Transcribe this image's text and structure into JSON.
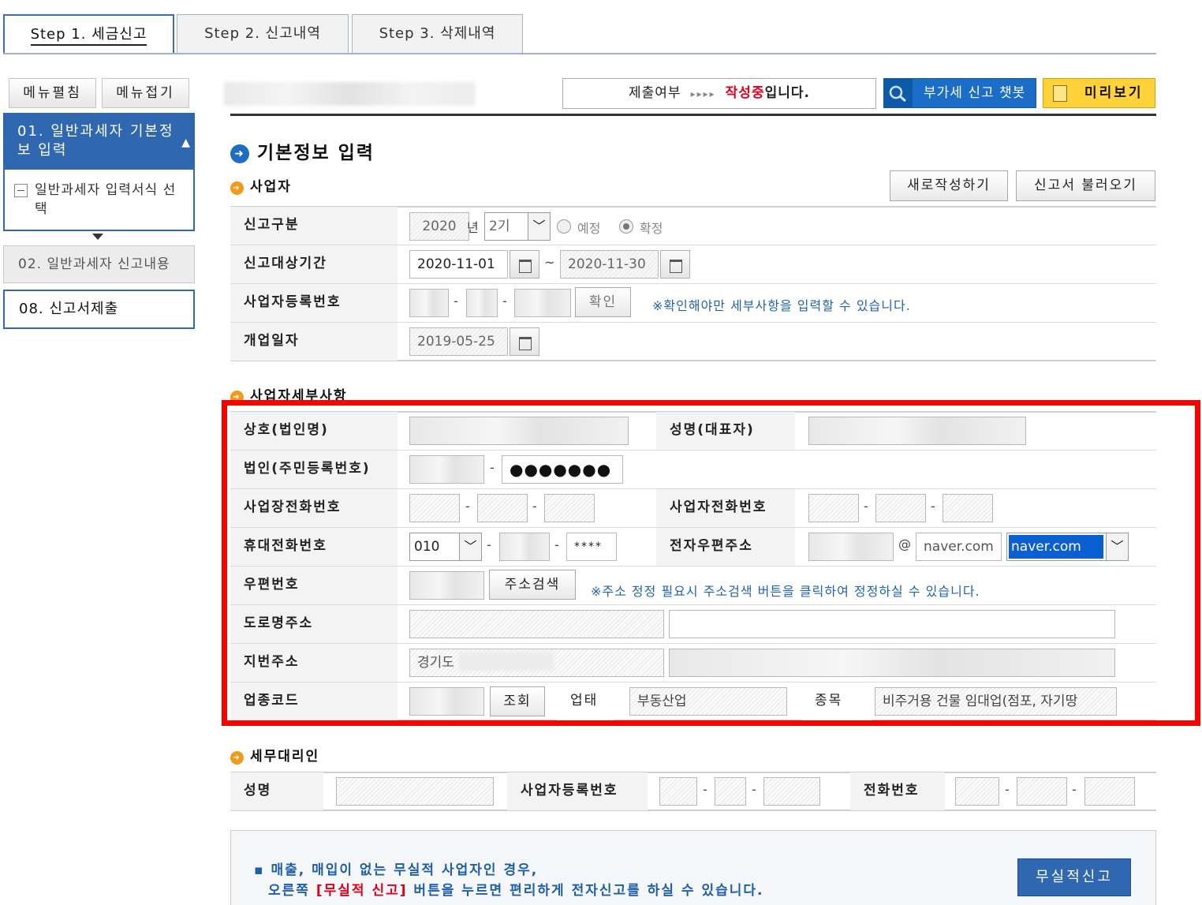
{
  "tabs": [
    {
      "label": "Step  1. 세금신고"
    },
    {
      "label": "Step  2. 신고내역"
    },
    {
      "label": "Step  3. 삭제내역"
    }
  ],
  "left_menu": {
    "expand_label": "메뉴펼침",
    "collapse_label": "메뉴접기",
    "active_item": "01. 일반과세자 기본정보 입력",
    "sub_item": "일반과세자 입력서식 선택",
    "item2": "02. 일반과세자 신고내용",
    "item3": "08. 신고서제출"
  },
  "status": {
    "prefix": "제출여부",
    "arrows": "▸▸▸▸",
    "state": "작성중",
    "suffix": "입니다."
  },
  "chatbot_label": "부가세 신고 챗봇",
  "preview_label": "미리보기",
  "section_title": "기본정보 입력",
  "business": {
    "heading": "사업자",
    "new_button": "새로작성하기",
    "load_button": "신고서 불러오기",
    "report_type_label": "신고구분",
    "year": "2020",
    "year_unit": "년",
    "period": "2기",
    "radio_prelim": "예정",
    "radio_final": "확정",
    "period_label": "신고대상기간",
    "period_start": "2020-11-01",
    "period_tilde": "~",
    "period_end": "2020-11-30",
    "biz_reg_label": "사업자등록번호",
    "confirm_button": "확인",
    "confirm_note": "※확인해야만 세부사항을 입력할 수 있습니다.",
    "open_date_label": "개업일자",
    "open_date": "2019-05-25"
  },
  "details": {
    "heading": "사업자세부사항",
    "company_label": "상호(법인명)",
    "rep_label": "성명(대표자)",
    "corp_id_label": "법인(주민등록번호)",
    "corp_id_masked": "●●●●●●●",
    "biz_phone_label": "사업장전화번호",
    "owner_phone_label": "사업자전화번호",
    "mobile_label": "휴대전화번호",
    "mobile_prefix": "010",
    "mobile_last": "****",
    "email_label": "전자우편주소",
    "email_at": "@",
    "email_domain": "naver.com",
    "email_domain_select": "naver.com",
    "zip_label": "우편번호",
    "address_search_button": "주소검색",
    "address_note": "※주소 정정 필요시 주소검색 버튼을 클릭하여 정정하실 수 있습니다.",
    "road_address_label": "도로명주소",
    "lot_address_label": "지번주소",
    "lot_address_value": "경기도",
    "industry_code_label": "업종코드",
    "lookup_button": "조회",
    "business_type_label": "업태",
    "business_type_value": "부동산업",
    "item_label": "종목",
    "item_value": "비주거용 건물 임대업(점포, 자기땅"
  },
  "agent": {
    "heading": "세무대리인",
    "name_label": "성명",
    "reg_label": "사업자등록번호",
    "phone_label": "전화번호"
  },
  "info": {
    "line1": "▪ 매출, 매입이 없는 무실적 사업자인 경우,",
    "line2_pre": "오른쪽 ",
    "line2_red": "[무실적 신고]",
    "line2_post": " 버튼을 누르면 편리하게 전자신고를 하실 수 있습니다.",
    "button": "무실적신고"
  }
}
